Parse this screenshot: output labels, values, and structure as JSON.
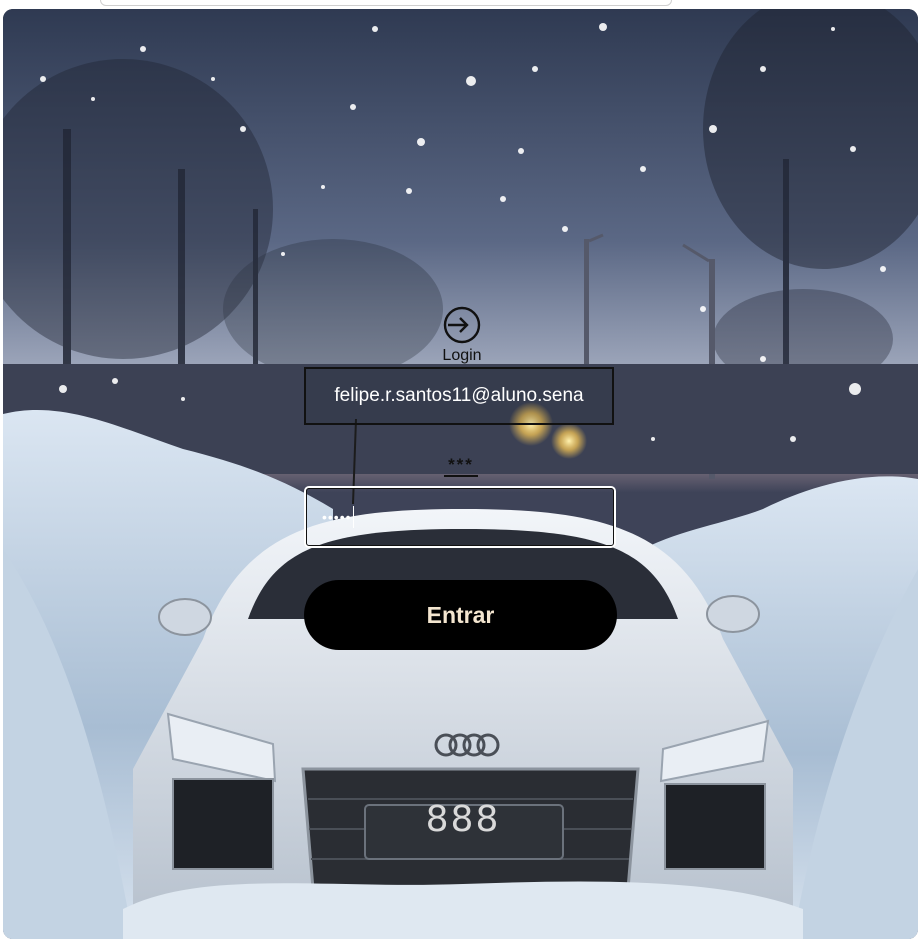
{
  "login": {
    "icon": "login-arrow-icon",
    "title": "Login",
    "email_value": "felipe.r.santos11@aluno.sena",
    "password_label": "***",
    "password_value": "•••••",
    "submit_label": "Entrar"
  },
  "background": {
    "description_icon": "snowy-car-background",
    "plate_text": "888"
  },
  "colors": {
    "button_bg": "#000000",
    "button_text": "#f4e6d0",
    "field_text": "#ffffff",
    "label_text": "#111111"
  }
}
